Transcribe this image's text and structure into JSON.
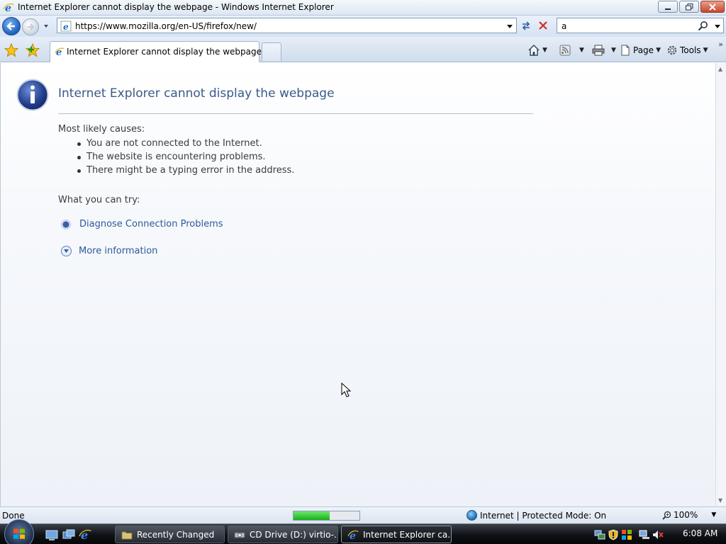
{
  "window": {
    "title": "Internet Explorer cannot display the webpage - Windows Internet Explorer"
  },
  "navbar": {
    "url": "https://www.mozilla.org/en-US/firefox/new/",
    "search_value": "a"
  },
  "tabbar": {
    "active_tab": "Internet Explorer cannot display the webpage",
    "page_label": "Page",
    "tools_label": "Tools",
    "chevrons": "»"
  },
  "content": {
    "title": "Internet Explorer cannot display the webpage",
    "causes_heading": "Most likely causes:",
    "causes": [
      "You are not connected to the Internet.",
      "The website is encountering problems.",
      "There might be a typing error in the address."
    ],
    "try_heading": "What you can try:",
    "diagnose_link": "Diagnose Connection Problems",
    "more_info_link": "More information"
  },
  "statusbar": {
    "status": "Done",
    "progress_fraction": 0.55,
    "zone": "Internet | Protected Mode: On",
    "zoom": "100%"
  },
  "taskbar": {
    "tasks": [
      "Recently Changed",
      "CD Drive (D:) virtio-...",
      "Internet Explorer ca..."
    ],
    "clock": "6:08 AM"
  },
  "colors": {
    "link": "#2c5a9c",
    "title": "#3a5a88",
    "progress": "#16b316"
  }
}
